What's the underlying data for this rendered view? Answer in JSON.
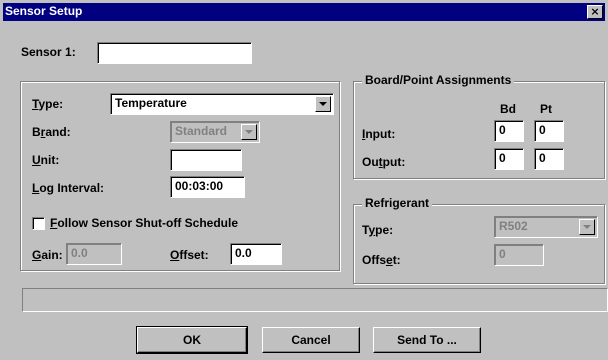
{
  "window": {
    "title": "Sensor Setup",
    "close_label": "×"
  },
  "sensor_name": {
    "label": "Sensor 1:",
    "value": ""
  },
  "type": {
    "label": "Type:",
    "value": "Temperature"
  },
  "brand": {
    "label": "Brand:",
    "value": "Standard"
  },
  "unit": {
    "label": "Unit:",
    "value": ""
  },
  "log_interval": {
    "label": "Log Interval:",
    "value": "00:03:00"
  },
  "follow_schedule": {
    "label": "Follow Sensor Shut-off Schedule",
    "checked": false
  },
  "gain": {
    "label": "Gain:",
    "value": "0.0"
  },
  "offset": {
    "label": "Offset:",
    "value": "0.0"
  },
  "board_point": {
    "title": "Board/Point Assignments",
    "col_bd": "Bd",
    "col_pt": "Pt",
    "input": {
      "label": "Input:",
      "bd": "0",
      "pt": "0"
    },
    "output": {
      "label": "Output:",
      "bd": "0",
      "pt": "0"
    }
  },
  "refrigerant": {
    "title": "Refrigerant",
    "type_label": "Type:",
    "type_value": "R502",
    "offset_label": "Offset:",
    "offset_value": "0"
  },
  "status_text": "",
  "buttons": {
    "ok": "OK",
    "cancel": "Cancel",
    "send_to": "Send To ..."
  },
  "colors": {
    "titlebar": "#000080",
    "face": "#c0c0c0",
    "field": "#ffffff"
  }
}
